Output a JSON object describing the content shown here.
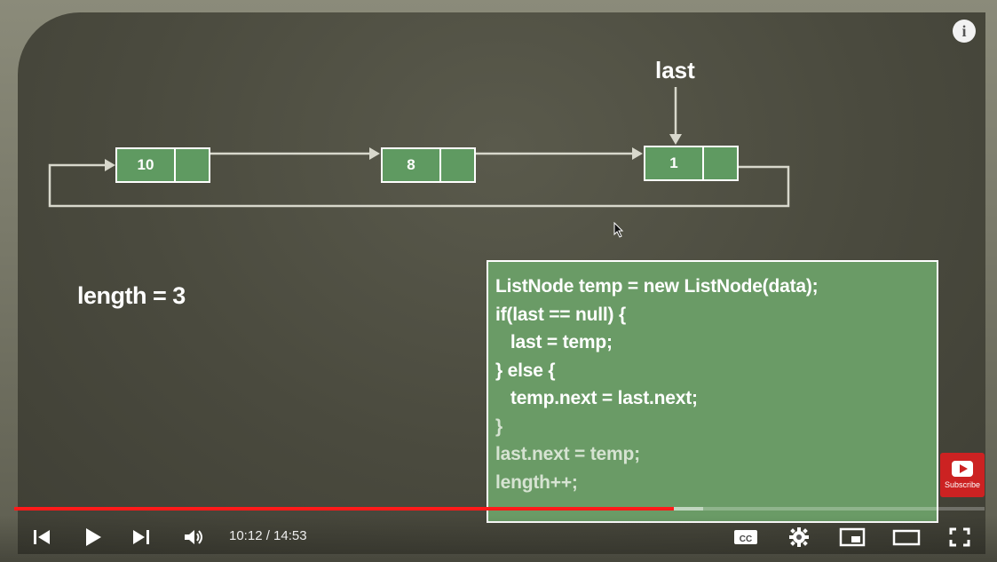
{
  "video": {
    "nodes": [
      {
        "value": "10"
      },
      {
        "value": "8"
      },
      {
        "value": "1"
      }
    ],
    "pointer_label": "last",
    "length_text": "length = 3",
    "code_lines": [
      {
        "text": "ListNode temp = new ListNode(data);",
        "dim": false
      },
      {
        "text": "if(last == null) {",
        "dim": false
      },
      {
        "text": "   last = temp;",
        "dim": false
      },
      {
        "text": "} else {",
        "dim": false
      },
      {
        "text": "   temp.next = last.next;",
        "dim": false
      },
      {
        "text": "}",
        "dim": true
      },
      {
        "text": "last.next = temp;",
        "dim": true
      },
      {
        "text": "length++;",
        "dim": true
      }
    ],
    "subscribe_label": "Subscribe"
  },
  "player": {
    "time_display": "10:12 / 14:53",
    "progress_played_fraction": 0.68,
    "progress_loaded_fraction": 0.71,
    "colors": {
      "progress": "#ff1a1a",
      "node_fill": "#5f9a61",
      "code_box": "#6a9b66"
    },
    "icons": [
      "previous-icon",
      "play-icon",
      "next-icon",
      "volume-icon",
      "captions-icon",
      "settings-icon",
      "miniplayer-icon",
      "theater-icon",
      "fullscreen-icon",
      "info-icon"
    ]
  }
}
